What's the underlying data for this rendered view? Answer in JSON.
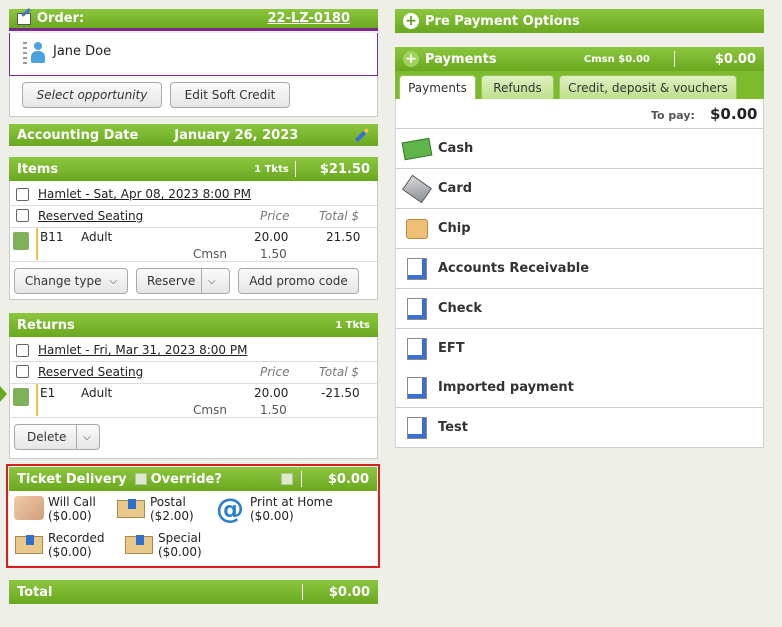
{
  "order": {
    "title": "Order:",
    "number": "22-LZ-0180",
    "customer": "Jane Doe",
    "select_opportunity": "Select opportunity",
    "edit_soft_credit": "Edit Soft Credit"
  },
  "accounting": {
    "label": "Accounting Date",
    "date": "January 26, 2023"
  },
  "items": {
    "title": "Items",
    "tkts": "1 Tkts",
    "total": "$21.50",
    "event": "Hamlet - Sat, Apr 08, 2023 8:00 PM",
    "seating": "Reserved Seating",
    "price_header": "Price",
    "total_header": "Total $",
    "seat": "B11",
    "type": "Adult",
    "price": "20.00",
    "line_total": "21.50",
    "cmsn_label": "Cmsn",
    "cmsn": "1.50",
    "change_type": "Change type",
    "reserve": "Reserve",
    "add_promo": "Add promo code"
  },
  "returns": {
    "title": "Returns",
    "tkts": "1 Tkts",
    "event": "Hamlet - Fri, Mar 31, 2023 8:00 PM",
    "seating": "Reserved Seating",
    "price_header": "Price",
    "total_header": "Total $",
    "seat": "E1",
    "type": "Adult",
    "price": "20.00",
    "line_total": "-21.50",
    "cmsn_label": "Cmsn",
    "cmsn": "1.50",
    "delete": "Delete"
  },
  "delivery": {
    "title": "Ticket Delivery",
    "override": "Override?",
    "amount": "$0.00",
    "options": [
      {
        "name": "Will Call",
        "price": "($0.00)"
      },
      {
        "name": "Postal",
        "price": "($2.00)"
      },
      {
        "name": "Print at Home",
        "price": "($0.00)"
      },
      {
        "name": "Recorded",
        "price": "($0.00)"
      },
      {
        "name": "Special",
        "price": "($0.00)"
      }
    ]
  },
  "total": {
    "label": "Total",
    "amount": "$0.00"
  },
  "prepayment": {
    "title": "Pre Payment Options"
  },
  "payments": {
    "title": "Payments",
    "cmsn": "Cmsn $0.00",
    "amount": "$0.00",
    "tabs": [
      "Payments",
      "Refunds",
      "Credit, deposit & vouchers"
    ],
    "to_pay_label": "To pay:",
    "to_pay": "$0.00",
    "methods": [
      "Cash",
      "Card",
      "Chip",
      "Accounts Receivable",
      "Check",
      "EFT",
      "Imported payment",
      "Test"
    ]
  },
  "colors": {
    "green": "#7dbb2e",
    "highlight_border": "#d42020",
    "order_border": "#7a2a8a"
  }
}
